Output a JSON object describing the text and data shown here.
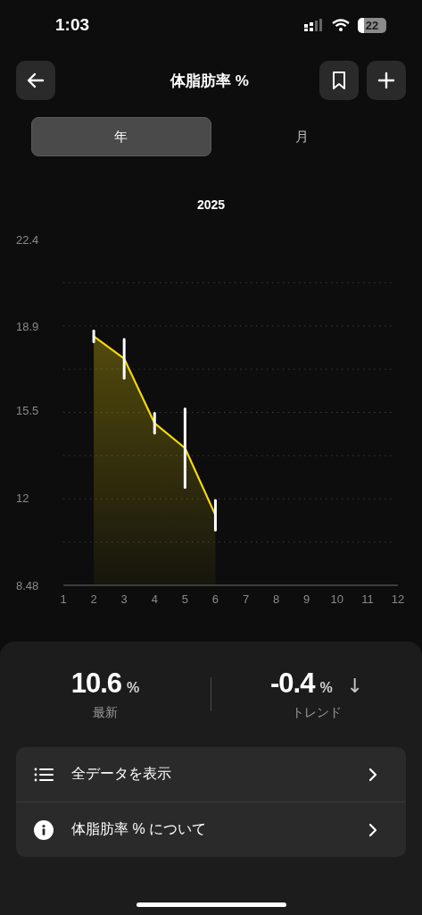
{
  "status_bar": {
    "time": "1:03",
    "battery": "22"
  },
  "header": {
    "title": "体脂肪率 %"
  },
  "tabs": [
    {
      "label": "年",
      "selected": true
    },
    {
      "label": "月",
      "selected": false
    }
  ],
  "chart": {
    "chart_data": {
      "type": "line",
      "title": "2025",
      "x": [
        2,
        3,
        4,
        5,
        6
      ],
      "series": [
        {
          "color": "#f5d90a",
          "values": [
            18.5,
            17.6,
            15.0,
            14.0,
            11.3
          ],
          "errors": [
            0.22,
            0.78,
            0.4,
            1.58,
            0.6
          ]
        }
      ],
      "grid": true,
      "xlim": [
        1,
        12
      ],
      "ylim": [
        8.48,
        22.4
      ],
      "xticks": [
        1,
        2,
        3,
        4,
        5,
        6,
        7,
        8,
        9,
        10,
        11,
        12
      ],
      "yticks": [
        22.4,
        18.9,
        15.5,
        12,
        8.48
      ]
    }
  },
  "stats": [
    {
      "value": "10.6",
      "unit": "%",
      "label": "最新"
    },
    {
      "value": "-0.4",
      "unit": "%",
      "label": "トレンド",
      "arrow": "↓"
    }
  ],
  "menu": [
    {
      "kind": "list",
      "label": "全データを表示"
    },
    {
      "kind": "info",
      "label": "体脂肪率 % について"
    }
  ]
}
